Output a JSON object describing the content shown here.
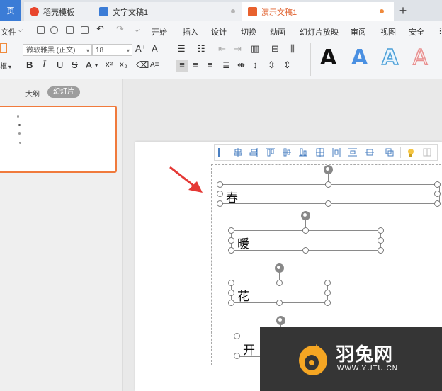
{
  "tabs": {
    "home": "页",
    "doc1": "稻壳模板",
    "doc2": "文字文稿1",
    "doc3": "演示文稿1",
    "plus": "+"
  },
  "menu": {
    "file": "文件",
    "items": [
      "开始",
      "插入",
      "设计",
      "切换",
      "动画",
      "幻灯片放映",
      "审阅",
      "视图",
      "安全"
    ]
  },
  "ribbon": {
    "font_name": "微软雅黑 (正文)",
    "font_size": "18",
    "grow_font": "A⁺",
    "shrink_font": "A⁻",
    "bold": "B",
    "italic": "I",
    "underline": "U",
    "strike": "S",
    "font_color": "A",
    "superscript": "X²",
    "subscript": "X₂",
    "left_cut": "框",
    "style_gallery": [
      "A",
      "A",
      "A",
      "A"
    ]
  },
  "left_panel": {
    "outline_tab": "大纲",
    "slides_tab": "幻灯片"
  },
  "slide": {
    "boxes": [
      "春",
      "暖",
      "花",
      "开"
    ]
  },
  "watermark": {
    "name": "羽兔网",
    "url": "WWW.YUTU.CN"
  },
  "colors": {
    "accent_orange": "#e0612e",
    "arrow_red": "#e53935",
    "logo_orange": "#f5a623",
    "home_blue": "#3b7cd6"
  }
}
